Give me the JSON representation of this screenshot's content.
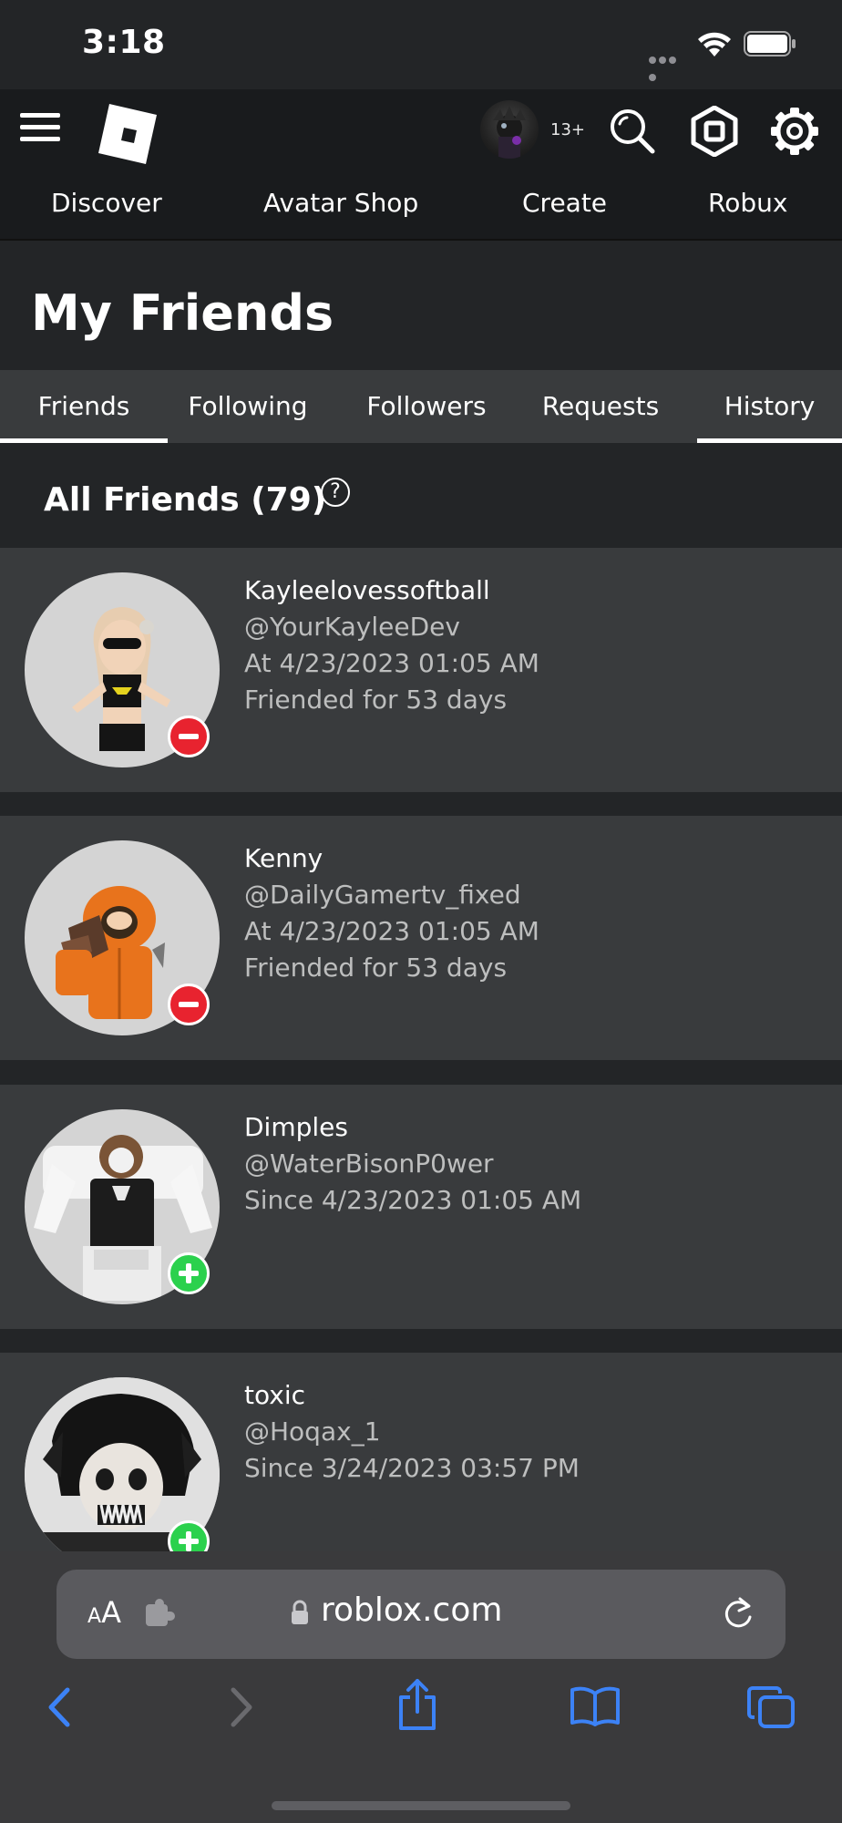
{
  "status_bar": {
    "time": "3:18"
  },
  "header": {
    "age_label": "13+",
    "nav": [
      "Discover",
      "Avatar Shop",
      "Create",
      "Robux"
    ]
  },
  "page": {
    "title": "My Friends"
  },
  "tabs": [
    {
      "label": "Friends",
      "active": true
    },
    {
      "label": "Following",
      "active": false
    },
    {
      "label": "Followers",
      "active": false
    },
    {
      "label": "Requests",
      "active": false
    },
    {
      "label": "History",
      "active": true
    }
  ],
  "section": {
    "title": "All Friends (79)",
    "help_glyph": "?"
  },
  "friends": [
    {
      "name": "Kayleelovessoftball",
      "username": "@YourKayleeDev",
      "date_line": "At 4/23/2023 01:05 AM",
      "duration": "Friended for 53 days",
      "action": "remove"
    },
    {
      "name": "Kenny",
      "username": "@DailyGamertv_fixed",
      "date_line": "At 4/23/2023 01:05 AM",
      "duration": "Friended for 53 days",
      "action": "remove"
    },
    {
      "name": "Dimples",
      "username": "@WaterBisonP0wer",
      "date_line": "Since 4/23/2023 01:05 AM",
      "duration": "",
      "action": "add"
    },
    {
      "name": "toxic",
      "username": "@Hoqax_1",
      "date_line": "Since 3/24/2023 03:57 PM",
      "duration": "",
      "action": "add"
    }
  ],
  "browser": {
    "text_size_label_small": "A",
    "text_size_label_large": "A",
    "url": "roblox.com"
  },
  "colors": {
    "remove_badge": "#e8232f",
    "add_badge": "#2bd14d",
    "safari_accent": "#3c82f6"
  },
  "icons": [
    "menu-icon",
    "roblox-logo",
    "search-icon",
    "robux-icon",
    "gear-icon",
    "lock-icon",
    "reload-icon",
    "back-icon",
    "forward-icon",
    "share-icon",
    "bookmarks-icon",
    "tabs-icon"
  ]
}
